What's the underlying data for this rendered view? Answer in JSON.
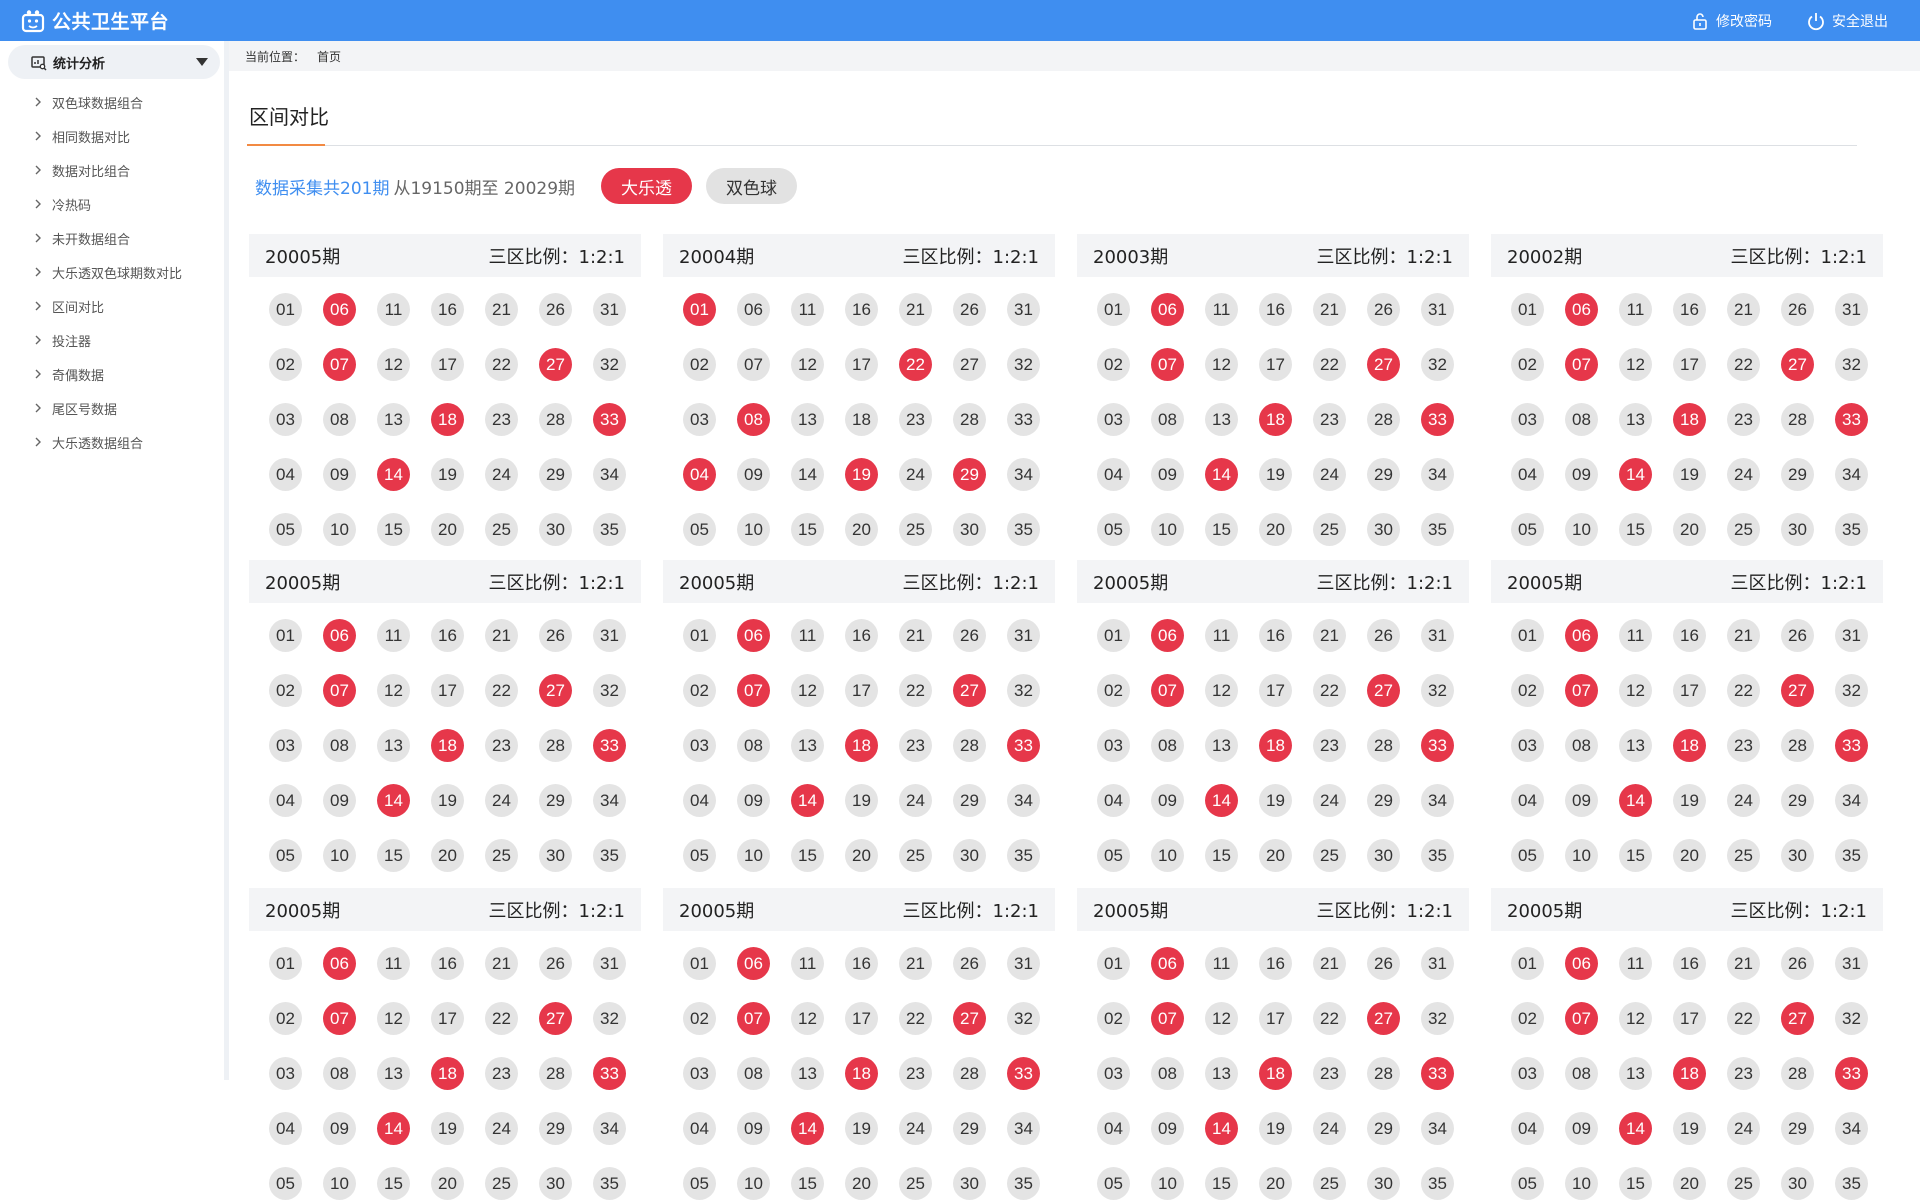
{
  "app": {
    "title": "公共卫生平台"
  },
  "header": {
    "change_password": "修改密码",
    "logout": "安全退出"
  },
  "sidebar": {
    "group_title": "统计分析",
    "items": [
      {
        "label": "双色球数据组合"
      },
      {
        "label": "相同数据对比"
      },
      {
        "label": "数据对比组合"
      },
      {
        "label": "冷热码"
      },
      {
        "label": "未开数据组合"
      },
      {
        "label": "大乐透双色球期数对比"
      },
      {
        "label": "区间对比"
      },
      {
        "label": "投注器"
      },
      {
        "label": "奇偶数据"
      },
      {
        "label": "尾区号数据"
      },
      {
        "label": "大乐透数据组合"
      }
    ]
  },
  "breadcrumb": {
    "prefix": "当前位置：",
    "current": "首页"
  },
  "page": {
    "title": "区间对比",
    "summary_count": "数据采集共201期",
    "summary_range": "从19150期至 20029期",
    "tab_active": "大乐透",
    "tab_inactive": "双色球"
  },
  "cards": [
    {
      "period": "20005期",
      "ratio": "三区比例：1:2:1",
      "hits": [
        "06",
        "07",
        "14",
        "18",
        "27",
        "33"
      ]
    },
    {
      "period": "20004期",
      "ratio": "三区比例：1:2:1",
      "hits": [
        "01",
        "04",
        "08",
        "19",
        "22",
        "29"
      ]
    },
    {
      "period": "20003期",
      "ratio": "三区比例：1:2:1",
      "hits": [
        "06",
        "07",
        "14",
        "18",
        "27",
        "33"
      ]
    },
    {
      "period": "20002期",
      "ratio": "三区比例：1:2:1",
      "hits": [
        "06",
        "07",
        "14",
        "18",
        "27",
        "33"
      ]
    },
    {
      "period": "20005期",
      "ratio": "三区比例：1:2:1",
      "hits": [
        "06",
        "07",
        "14",
        "18",
        "27",
        "33"
      ]
    },
    {
      "period": "20005期",
      "ratio": "三区比例：1:2:1",
      "hits": [
        "06",
        "07",
        "14",
        "18",
        "27",
        "33"
      ]
    },
    {
      "period": "20005期",
      "ratio": "三区比例：1:2:1",
      "hits": [
        "06",
        "07",
        "14",
        "18",
        "27",
        "33"
      ]
    },
    {
      "period": "20005期",
      "ratio": "三区比例：1:2:1",
      "hits": [
        "06",
        "07",
        "14",
        "18",
        "27",
        "33"
      ]
    },
    {
      "period": "20005期",
      "ratio": "三区比例：1:2:1",
      "hits": [
        "06",
        "07",
        "14",
        "18",
        "27",
        "33"
      ]
    },
    {
      "period": "20005期",
      "ratio": "三区比例：1:2:1",
      "hits": [
        "06",
        "07",
        "14",
        "18",
        "27",
        "33"
      ]
    },
    {
      "period": "20005期",
      "ratio": "三区比例：1:2:1",
      "hits": [
        "06",
        "07",
        "14",
        "18",
        "27",
        "33"
      ]
    },
    {
      "period": "20005期",
      "ratio": "三区比例：1:2:1",
      "hits": [
        "06",
        "07",
        "14",
        "18",
        "27",
        "33"
      ]
    }
  ],
  "ball_rows": [
    [
      "01",
      "06",
      "11",
      "16",
      "21",
      "26",
      "31"
    ],
    [
      "02",
      "07",
      "12",
      "17",
      "22",
      "27",
      "32"
    ],
    [
      "03",
      "08",
      "13",
      "18",
      "23",
      "28",
      "33"
    ],
    [
      "04",
      "09",
      "14",
      "19",
      "24",
      "29",
      "34"
    ],
    [
      "05",
      "10",
      "15",
      "20",
      "25",
      "30",
      "35"
    ]
  ],
  "colors": {
    "primary": "#3f8ef0",
    "hit": "#e6374a",
    "ball": "#e4e4e4",
    "accent": "#f28a43"
  }
}
